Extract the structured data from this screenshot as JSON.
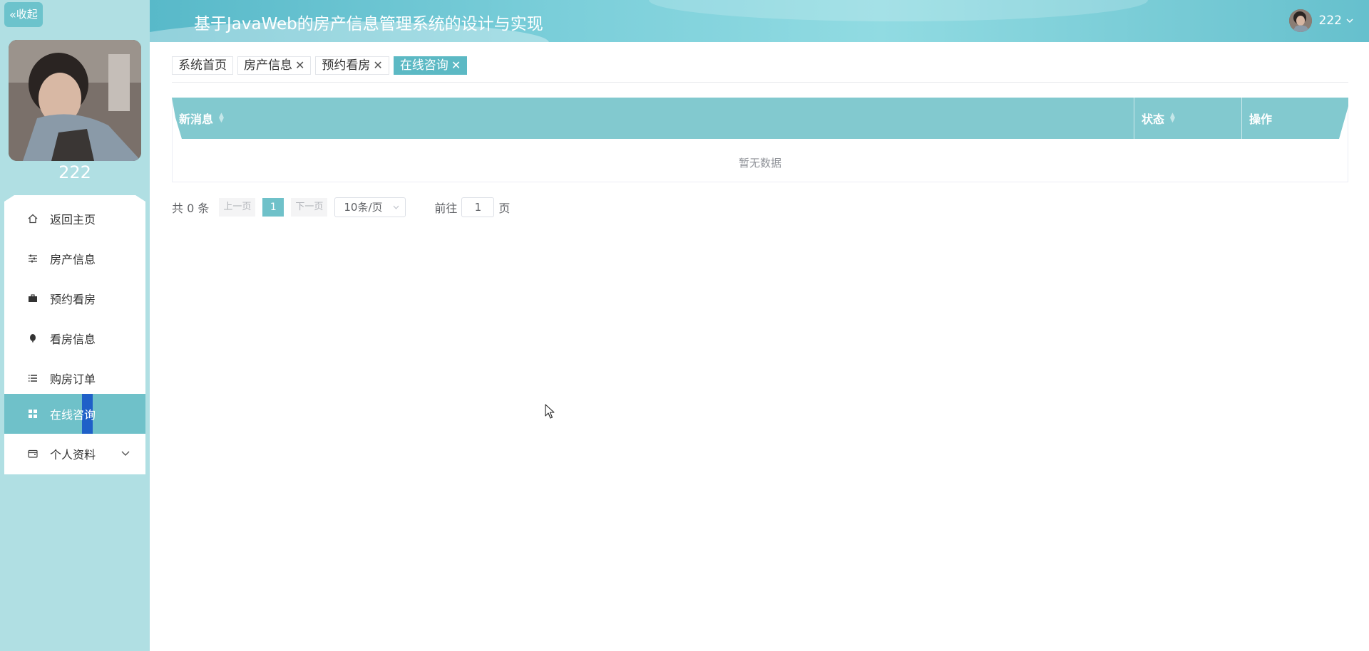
{
  "sidebar": {
    "collapse_label": "收起",
    "username": "222",
    "items": [
      {
        "label": "返回主页",
        "icon": "home-icon"
      },
      {
        "label": "房产信息",
        "icon": "sliders-icon"
      },
      {
        "label": "预约看房",
        "icon": "briefcase-icon"
      },
      {
        "label": "看房信息",
        "icon": "pin-icon"
      },
      {
        "label": "购房订单",
        "icon": "list-icon"
      },
      {
        "label": "在线咨询",
        "icon": "grid-icon",
        "active": true
      },
      {
        "label": "个人资料",
        "icon": "wallet-icon",
        "has_submenu": true
      }
    ]
  },
  "header": {
    "title": "基于JavaWeb的房产信息管理系统的设计与实现",
    "username": "222"
  },
  "tabs": [
    {
      "label": "系统首页",
      "closable": false
    },
    {
      "label": "房产信息",
      "closable": true
    },
    {
      "label": "预约看房",
      "closable": true
    },
    {
      "label": "在线咨询",
      "closable": true,
      "active": true
    }
  ],
  "table": {
    "columns": [
      "新消息",
      "状态",
      "操作"
    ],
    "empty_text": "暂无数据"
  },
  "pagination": {
    "total_label": "共 0 条",
    "prev_label": "上一页",
    "current_page": "1",
    "next_label": "下一页",
    "page_size_label": "10条/页",
    "goto_prefix": "前往",
    "goto_value": "1",
    "goto_suffix": "页"
  },
  "colors": {
    "sidebar_bg": "#b0dfe3",
    "accent": "#6fc1c9",
    "active_indicator": "#1f60c8",
    "table_header": "#82c9cf"
  }
}
